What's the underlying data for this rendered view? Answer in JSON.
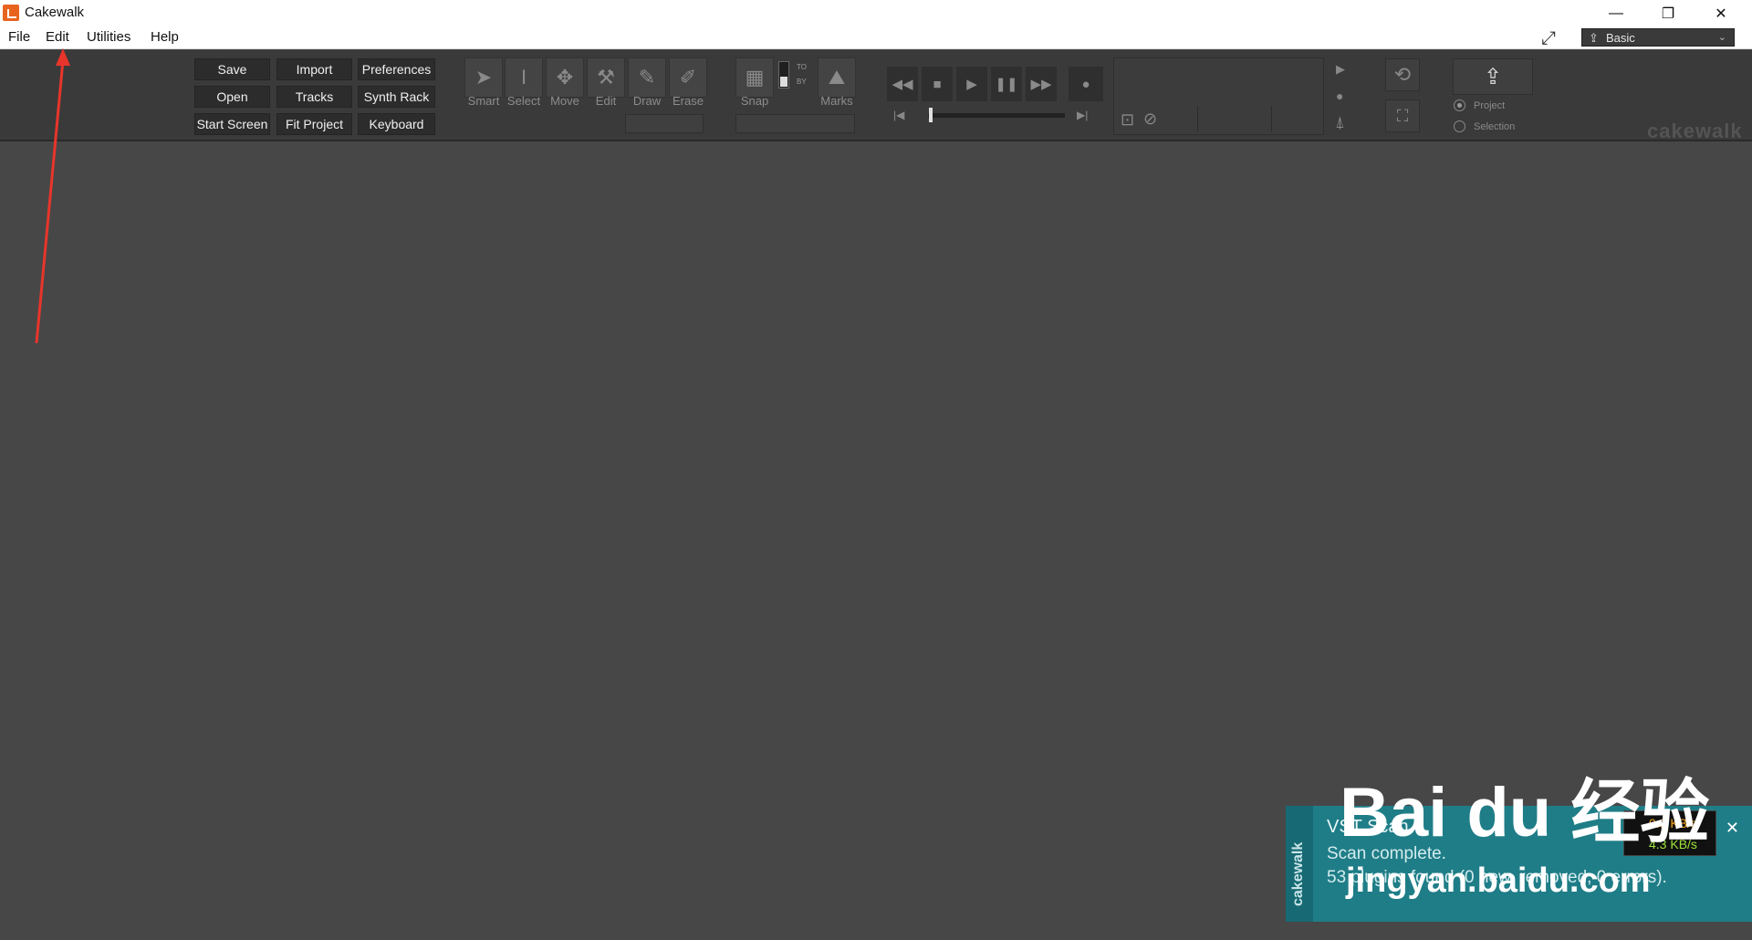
{
  "window": {
    "title": "Cakewalk",
    "minimize_glyph": "—",
    "restore_glyph": "❐",
    "close_glyph": "✕"
  },
  "menu": {
    "items": [
      "File",
      "Edit",
      "Utilities",
      "Help"
    ]
  },
  "workspace_select": {
    "value": "Basic",
    "icon": "share-icon",
    "caret": "⌄"
  },
  "control_bar": {
    "buttons": [
      "Save",
      "Import",
      "Preferences",
      "Open",
      "Tracks",
      "Synth Rack",
      "Start Screen",
      "Fit Project",
      "Keyboard"
    ],
    "tools": [
      {
        "label": "Smart",
        "icon": "arrow-cursor-icon",
        "glyph": "➤"
      },
      {
        "label": "Select",
        "icon": "i-beam-icon",
        "glyph": "I"
      },
      {
        "label": "Move",
        "icon": "move-arrows-icon",
        "glyph": "✥"
      },
      {
        "label": "Edit",
        "icon": "wrench-icon",
        "glyph": "⚒"
      },
      {
        "label": "Draw",
        "icon": "pencil-icon",
        "glyph": "✎"
      },
      {
        "label": "Erase",
        "icon": "eraser-icon",
        "glyph": "✐"
      }
    ],
    "snap": {
      "label": "Snap",
      "to": "TO",
      "by": "BY"
    },
    "marks": {
      "label": "Marks"
    },
    "transport": {
      "rewind": "◀◀",
      "stop": "■",
      "play": "▶",
      "pause": "❚❚",
      "forward": "▶▶",
      "record": "●",
      "go_start": "|◀",
      "go_end": "▶|"
    },
    "export_options": {
      "project": "Project",
      "selection": "Selection",
      "selected": "Project"
    },
    "brand": "cakewalk"
  },
  "notification": {
    "side_label": "cakewalk",
    "title": "VST Scan",
    "line1": "Scan complete.",
    "line2": "53 plugins found (0 new, removed, 0 errors).",
    "close": "✕"
  },
  "network": {
    "up": "0.3 KB/s",
    "down": "4.3 KB/s"
  },
  "watermark": {
    "brand": "Bai du 经验",
    "url": "jingyan.baidu.com"
  },
  "colors": {
    "accent": "#e8641e",
    "toast": "#1f7d87",
    "annotation_arrow": "#e8352b"
  }
}
